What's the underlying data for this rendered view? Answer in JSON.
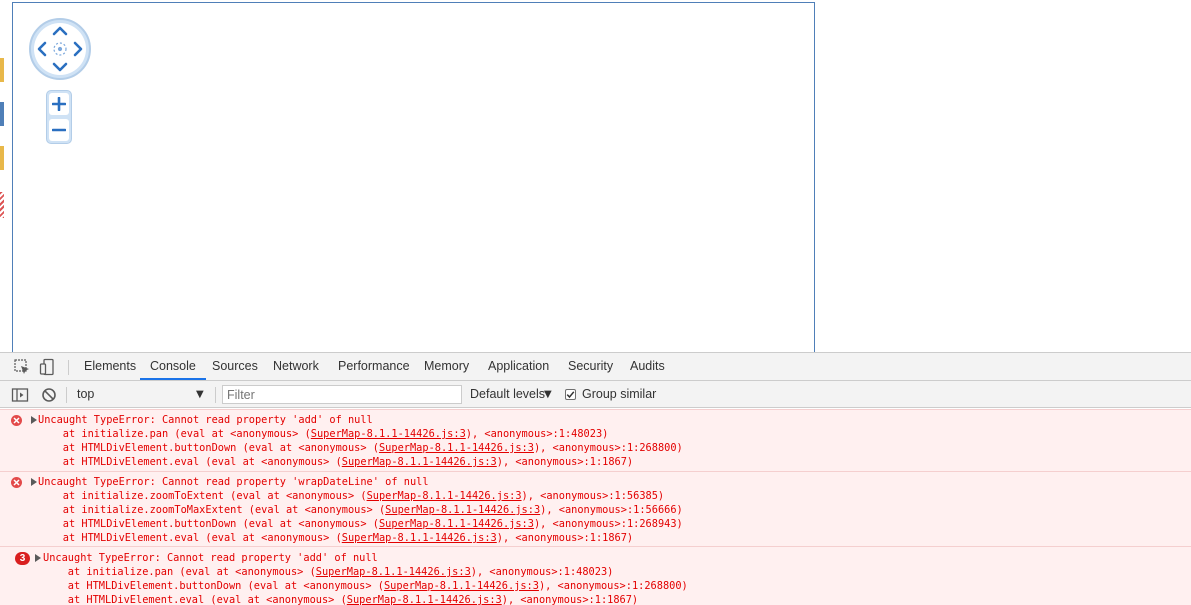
{
  "colors": {
    "tab_active_underline": "#1a73e8",
    "error_text": "#e30000",
    "error_background": "#fff0f0",
    "map_border": "#4f7fb8",
    "control_blue": "#cfe2f5"
  },
  "map": {
    "pan_icons": [
      "chevron-up-icon",
      "chevron-down-icon",
      "chevron-left-icon",
      "chevron-right-icon",
      "crosshair-icon"
    ],
    "zoom_in_label": "+",
    "zoom_out_label": "−"
  },
  "devtools": {
    "tabs": [
      {
        "label": "Elements",
        "active": false
      },
      {
        "label": "Console",
        "active": true
      },
      {
        "label": "Sources",
        "active": false
      },
      {
        "label": "Network",
        "active": false
      },
      {
        "label": "Performance",
        "active": false
      },
      {
        "label": "Memory",
        "active": false
      },
      {
        "label": "Application",
        "active": false
      },
      {
        "label": "Security",
        "active": false
      },
      {
        "label": "Audits",
        "active": false
      }
    ],
    "toolbar": {
      "context": "top",
      "filter_placeholder": "Filter",
      "levels": "Default levels",
      "group_similar_label": "Group similar",
      "group_similar_checked": true
    }
  },
  "console": {
    "messages": [
      {
        "count": 1,
        "header": "Uncaught TypeError: Cannot read property 'add' of null",
        "frames": [
          {
            "prefix": "    at initialize.pan (eval at <anonymous> (",
            "link": "SuperMap-8.1.1-14426.js:3",
            "suffix": "), <anonymous>:1:48023)"
          },
          {
            "prefix": "    at HTMLDivElement.buttonDown (eval at <anonymous> (",
            "link": "SuperMap-8.1.1-14426.js:3",
            "suffix": "), <anonymous>:1:268800)"
          },
          {
            "prefix": "    at HTMLDivElement.eval (eval at <anonymous> (",
            "link": "SuperMap-8.1.1-14426.js:3",
            "suffix": "), <anonymous>:1:1867)"
          }
        ]
      },
      {
        "count": 1,
        "header": "Uncaught TypeError: Cannot read property 'wrapDateLine' of null",
        "frames": [
          {
            "prefix": "    at initialize.zoomToExtent (eval at <anonymous> (",
            "link": "SuperMap-8.1.1-14426.js:3",
            "suffix": "), <anonymous>:1:56385)"
          },
          {
            "prefix": "    at initialize.zoomToMaxExtent (eval at <anonymous> (",
            "link": "SuperMap-8.1.1-14426.js:3",
            "suffix": "), <anonymous>:1:56666)"
          },
          {
            "prefix": "    at HTMLDivElement.buttonDown (eval at <anonymous> (",
            "link": "SuperMap-8.1.1-14426.js:3",
            "suffix": "), <anonymous>:1:268943)"
          },
          {
            "prefix": "    at HTMLDivElement.eval (eval at <anonymous> (",
            "link": "SuperMap-8.1.1-14426.js:3",
            "suffix": "), <anonymous>:1:1867)"
          }
        ]
      },
      {
        "count": 3,
        "count_label": "3",
        "header": "Uncaught TypeError: Cannot read property 'add' of null",
        "frames": [
          {
            "prefix": "    at initialize.pan (eval at <anonymous> (",
            "link": "SuperMap-8.1.1-14426.js:3",
            "suffix": "), <anonymous>:1:48023)"
          },
          {
            "prefix": "    at HTMLDivElement.buttonDown (eval at <anonymous> (",
            "link": "SuperMap-8.1.1-14426.js:3",
            "suffix": "), <anonymous>:1:268800)"
          },
          {
            "prefix": "    at HTMLDivElement.eval (eval at <anonymous> (",
            "link": "SuperMap-8.1.1-14426.js:3",
            "suffix": "), <anonymous>:1:1867)"
          }
        ]
      }
    ]
  }
}
